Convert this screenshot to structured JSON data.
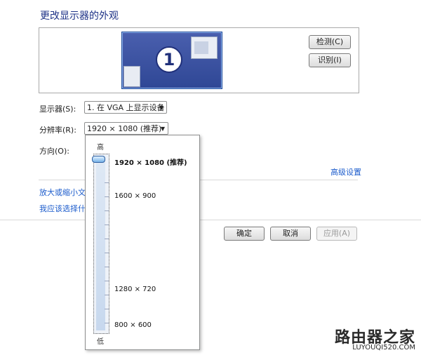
{
  "title": "更改显示器的外观",
  "monitor_number": "1",
  "buttons": {
    "detect": "检测(C)",
    "identify": "识别(I)",
    "ok": "确定",
    "cancel": "取消",
    "apply": "应用(A)"
  },
  "display": {
    "label": "显示器(S):",
    "value": "1. 在 VGA 上显示设备"
  },
  "resolution": {
    "label": "分辨率(R):",
    "value": "1920 × 1080 (推荐)",
    "high_label": "高",
    "low_label": "低",
    "options": [
      "1920 × 1080 (推荐)",
      "1600 × 900",
      "1280 × 720",
      "800 × 600"
    ],
    "selected_index": 0
  },
  "orientation": {
    "label": "方向(O):"
  },
  "links": {
    "advanced": "高级设置",
    "enlarge_text": "放大或缩小文本",
    "which_settings": "我应该选择什么"
  },
  "watermark": {
    "line1": "路由器之家",
    "line2": "LUYOUQI520.COM"
  }
}
